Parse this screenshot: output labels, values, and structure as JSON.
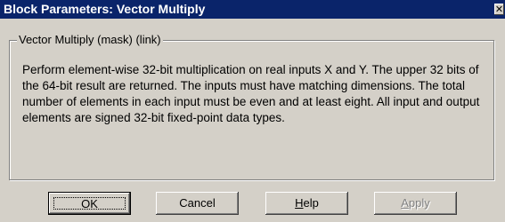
{
  "window": {
    "title": "Block Parameters: Vector Multiply",
    "close_glyph": "✕"
  },
  "group": {
    "legend": "Vector Multiply (mask) (link)",
    "description": "Perform element-wise 32-bit multiplication on real inputs X and Y. The upper 32 bits of the 64-bit result are returned. The inputs must have matching dimensions. The total number of elements in each input must be even and at least eight. All input and output elements are signed 32-bit fixed-point data types."
  },
  "buttons": {
    "ok": "OK",
    "cancel": "Cancel",
    "help_mnemonic": "H",
    "help_rest": "elp",
    "apply_mnemonic": "A",
    "apply_rest": "pply"
  },
  "colors": {
    "titlebar": "#0a246a",
    "face": "#d4d0c8"
  }
}
